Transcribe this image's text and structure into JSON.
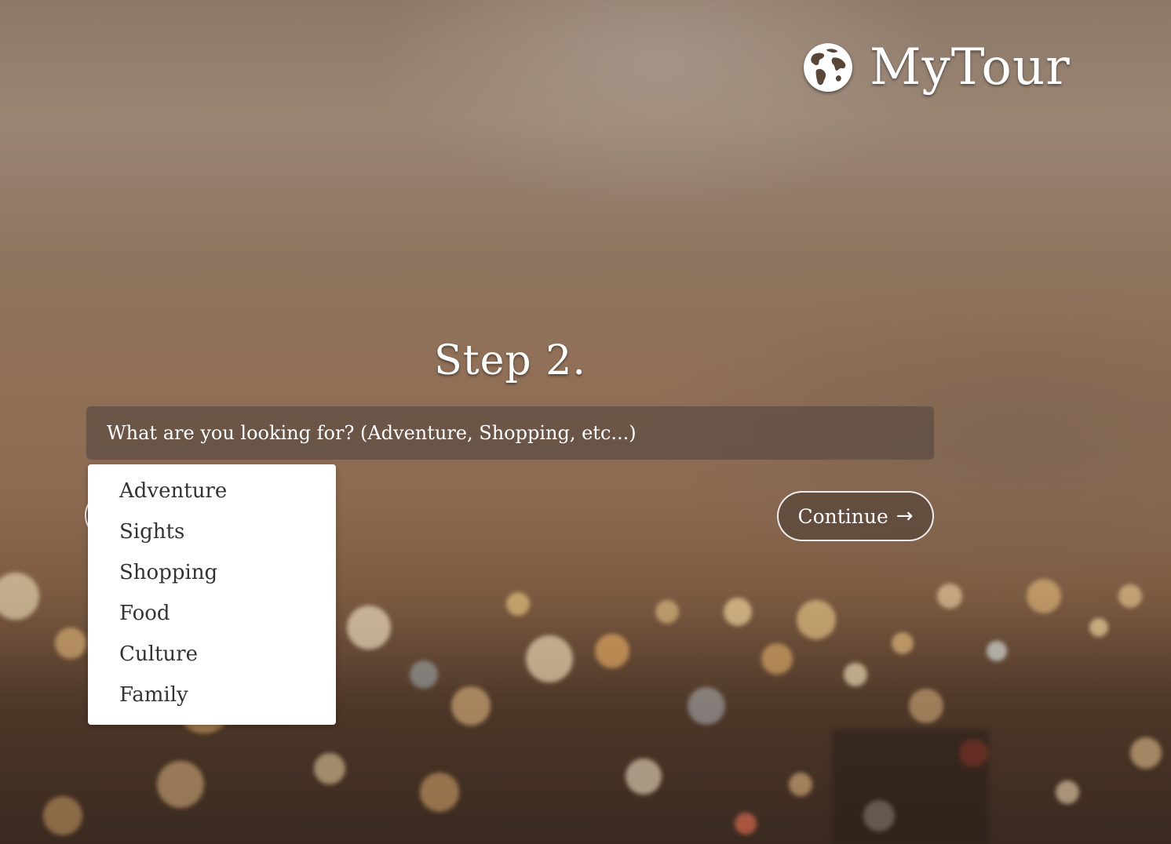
{
  "header": {
    "brand": "MyTour",
    "logo_icon": "globe-icon"
  },
  "step": {
    "title": "Step 2."
  },
  "search": {
    "placeholder": "What are you looking for? (Adventure, Shopping, etc...)",
    "value": ""
  },
  "dropdown": {
    "items": [
      "Adventure",
      "Sights",
      "Shopping",
      "Food",
      "Culture",
      "Family"
    ]
  },
  "actions": {
    "continue_label": "Continue",
    "continue_icon": "arrow-right-icon"
  },
  "colors": {
    "text": "#ffffff",
    "dropdown_text": "#333333",
    "input_bg": "#5c4c42",
    "button_bg": "#5c483a"
  }
}
